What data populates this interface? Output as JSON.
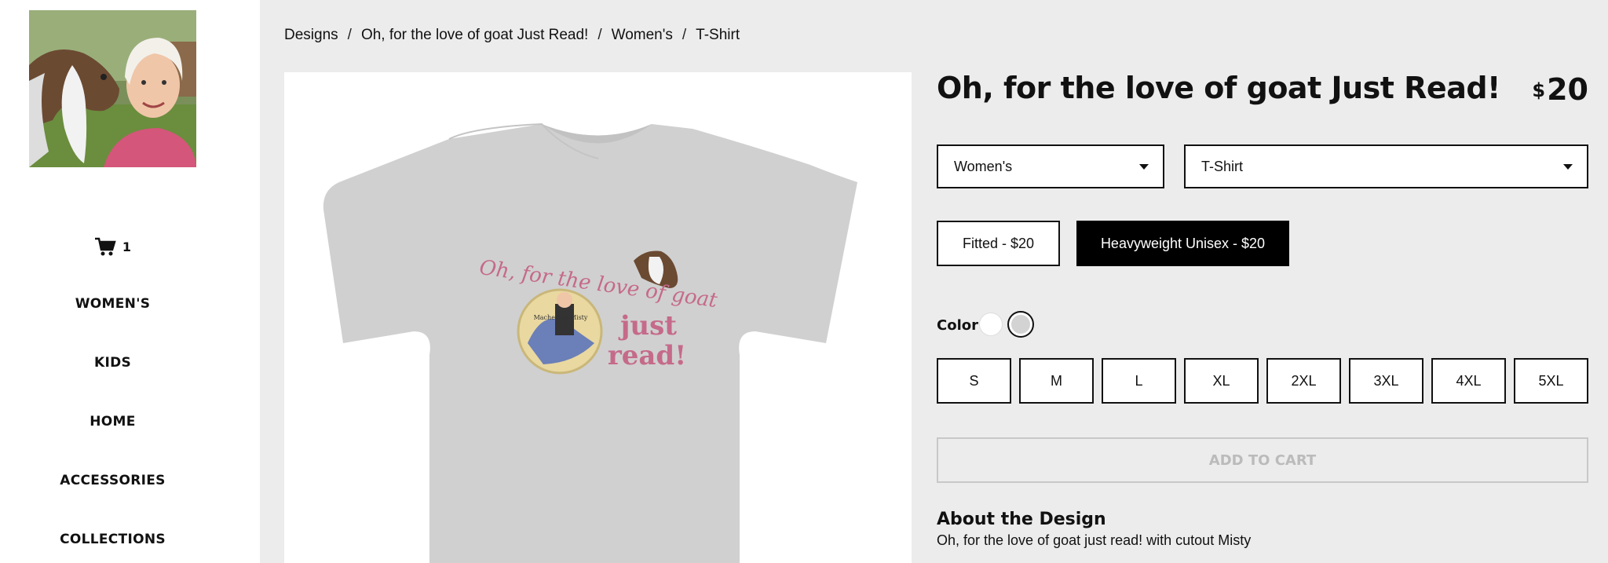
{
  "sidebar": {
    "cart_count": "1",
    "nav": [
      "WOMEN'S",
      "KIDS",
      "HOME",
      "ACCESSORIES",
      "COLLECTIONS"
    ]
  },
  "breadcrumb": [
    "Designs",
    "Oh, for the love of goat Just Read!",
    "Women's",
    "T-Shirt"
  ],
  "product": {
    "title": "Oh, for the love of goat Just Read!",
    "currency": "$",
    "price": "20",
    "gender": "Women's",
    "type": "T-Shirt",
    "styles": [
      {
        "label": "Fitted - $20",
        "selected": false
      },
      {
        "label": "Heavyweight Unisex - $20",
        "selected": true
      }
    ],
    "color_label": "Color",
    "colors": [
      {
        "hex": "#ffffff",
        "selected": false
      },
      {
        "hex": "#d3d3d3",
        "selected": true
      }
    ],
    "sizes": [
      "S",
      "M",
      "L",
      "XL",
      "2XL",
      "3XL",
      "4XL",
      "5XL"
    ],
    "add_to_cart": "ADD TO CART"
  },
  "design_print": {
    "line1": "Oh, for the love of goat",
    "line2": "just",
    "line3": "read!",
    "book_title": "Macheroni Misty"
  },
  "about": {
    "title": "About the Design",
    "text": "Oh, for the love of goat just read! with cutout Misty"
  }
}
